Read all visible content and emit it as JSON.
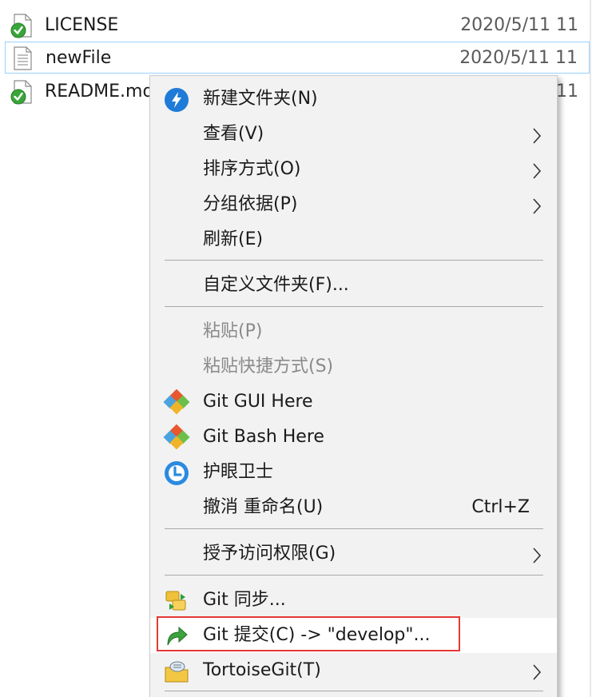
{
  "files": [
    {
      "name": "LICENSE",
      "date": "2020/5/11",
      "time": "11",
      "icon": "git-clean-file-icon"
    },
    {
      "name": "newFile",
      "date": "2020/5/11",
      "time": "11",
      "icon": "text-file-icon"
    },
    {
      "name": "README.md",
      "date": "",
      "time": "11",
      "icon": "git-clean-file-icon"
    }
  ],
  "menu": {
    "items": [
      {
        "label": "新建文件夹(N)",
        "icon": "new-folder-icon"
      },
      {
        "label": "查看(V)",
        "submenu": true
      },
      {
        "label": "排序方式(O)",
        "submenu": true
      },
      {
        "label": "分组依据(P)",
        "submenu": true
      },
      {
        "label": "刷新(E)"
      },
      {
        "label": "自定义文件夹(F)..."
      },
      {
        "label": "粘贴(P)",
        "disabled": true
      },
      {
        "label": "粘贴快捷方式(S)",
        "disabled": true
      },
      {
        "label": "Git GUI Here",
        "icon": "git-gui-icon"
      },
      {
        "label": "Git Bash Here",
        "icon": "git-bash-icon"
      },
      {
        "label": "护眼卫士",
        "icon": "eye-care-icon"
      },
      {
        "label": "撤消 重命名(U)",
        "shortcut": "Ctrl+Z"
      },
      {
        "label": "授予访问权限(G)",
        "submenu": true
      },
      {
        "label": "Git 同步...",
        "icon": "git-sync-icon"
      },
      {
        "label": "Git 提交(C) -> \"develop\"...",
        "icon": "git-commit-icon",
        "highlighted": true
      },
      {
        "label": "TortoiseGit(T)",
        "icon": "tortoisegit-icon",
        "submenu": true
      }
    ]
  },
  "colors": {
    "menu_bg": "#f2f2f2",
    "selection_border": "#99d1ff",
    "annotation_box": "#e53935",
    "disabled_text": "#8a8a8a"
  }
}
